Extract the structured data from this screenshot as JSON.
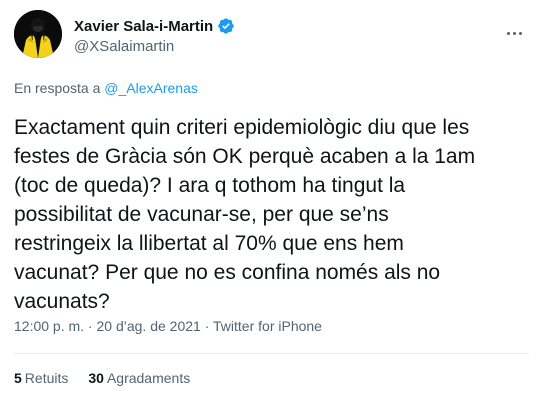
{
  "author": {
    "display_name": "Xavier Sala-i-Martin",
    "handle": "@XSalaimartin",
    "avatar_icon": "avatar-jacket-yellow-icon",
    "verified_icon": "verified-badge-icon",
    "verified_color": "#1d9bf0"
  },
  "reply": {
    "prefix": "En resposta a ",
    "to": "@_AlexArenas"
  },
  "tweet": {
    "text": "Exactament quin criteri epidemiològic diu que les\nfestes de Gràcia són OK perquè acaben a la 1am\n(toc de queda)? I ara q tothom ha tingut la\npossibilitat de vacunar-se, per que se’ns\nrestringeix la llibertat al 70% que ens hem\nvacunat? Per que no es confina només als no\nvacunats?"
  },
  "meta": {
    "time": "12:00 p. m.",
    "separator1": " · ",
    "date": "20 d’ag. de 2021",
    "separator2": " · ",
    "source": "Twitter for iPhone"
  },
  "stats": {
    "retweets_count": "5",
    "retweets_label": "Retuits",
    "likes_count": "30",
    "likes_label": "Agradaments"
  },
  "more_icon": "more-options-icon",
  "colors": {
    "text": "#0f1419",
    "secondary": "#536471",
    "link": "#1d9bf0",
    "divider": "#e6ecf0"
  }
}
